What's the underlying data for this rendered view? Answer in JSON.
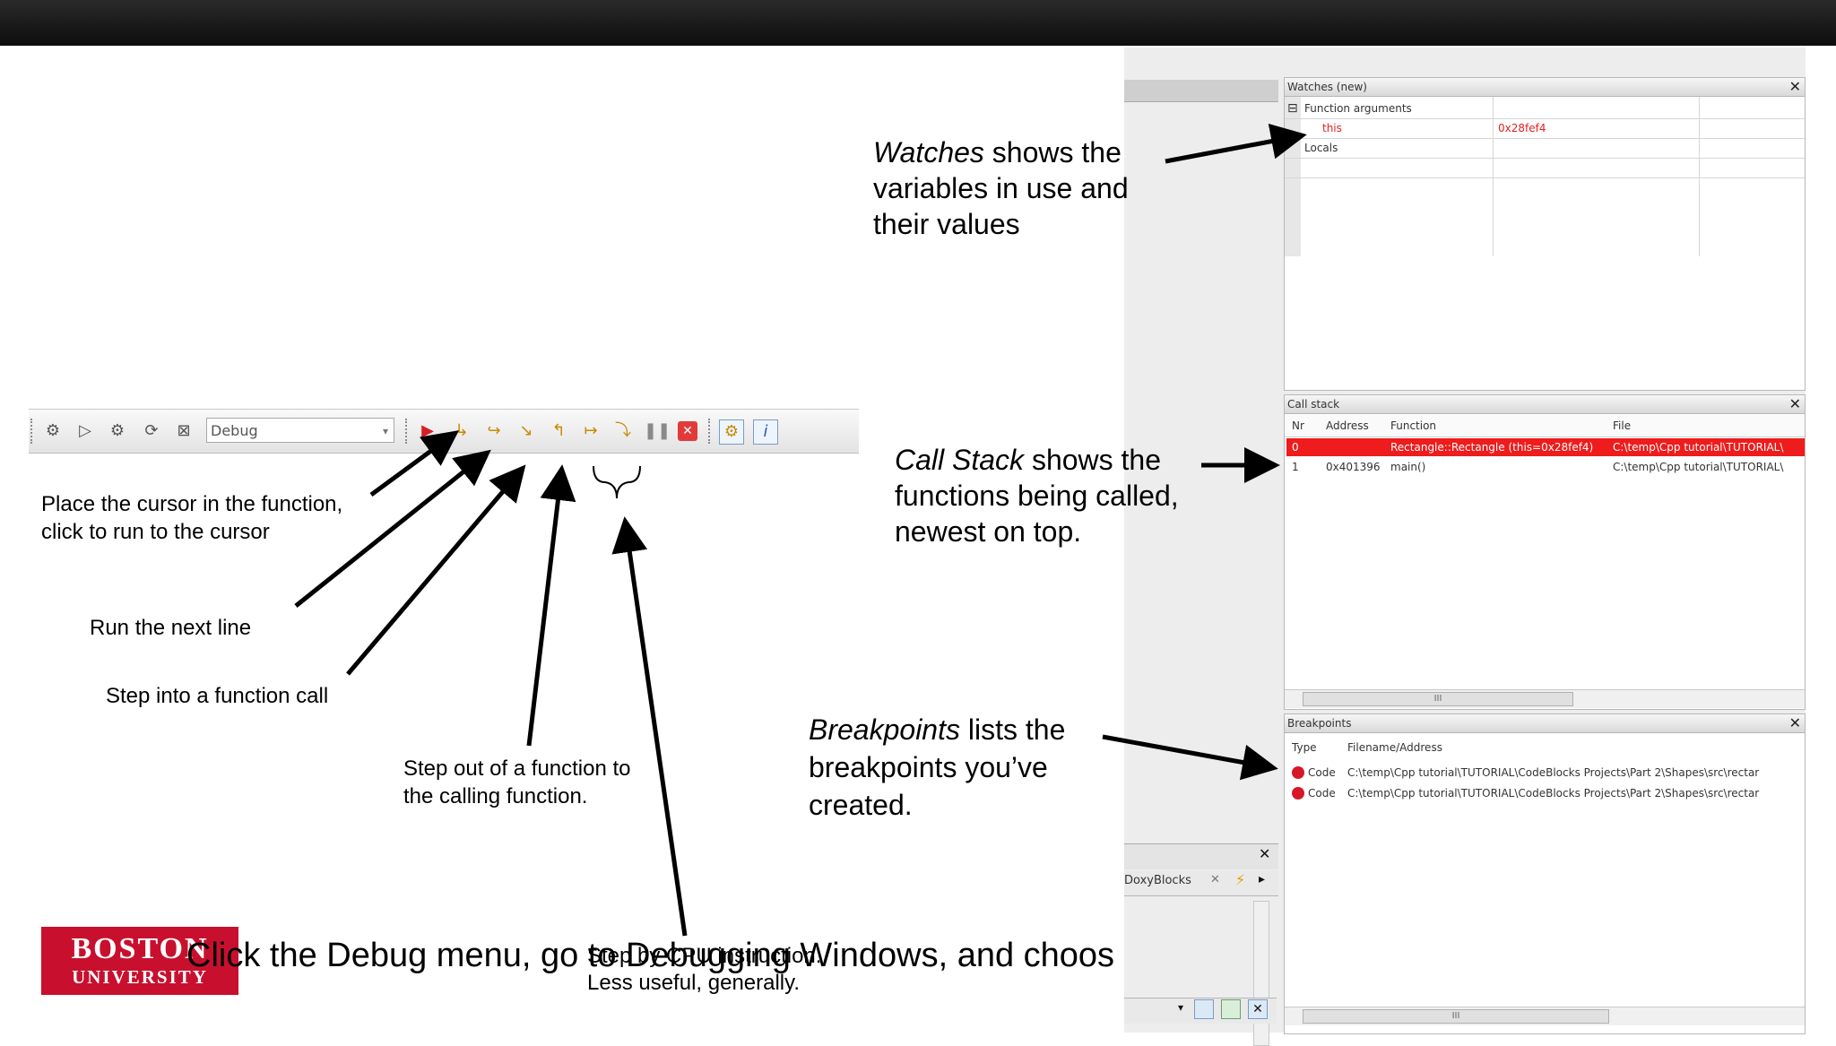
{
  "watches": {
    "title": "Watches (new)",
    "function_arguments": "Function arguments",
    "arg_name": "this",
    "arg_value": "0x28fef4",
    "locals": "Locals",
    "expand_symbol": "⊟"
  },
  "call_stack": {
    "title": "Call stack",
    "columns": [
      "Nr",
      "Address",
      "Function",
      "File"
    ],
    "rows": [
      {
        "nr": "0",
        "address": "",
        "function": "Rectangle::Rectangle (this=0x28fef4)",
        "file": "C:\\temp\\Cpp tutorial\\TUTORIAL\\"
      },
      {
        "nr": "1",
        "address": "0x401396",
        "function": "main()",
        "file": "C:\\temp\\Cpp tutorial\\TUTORIAL\\"
      }
    ],
    "scroll_marker": "III"
  },
  "breakpoints": {
    "title": "Breakpoints",
    "columns": [
      "Type",
      "Filename/Address"
    ],
    "rows": [
      {
        "type": "Code",
        "path": "C:\\temp\\Cpp tutorial\\TUTORIAL\\CodeBlocks Projects\\Part 2\\Shapes\\src\\rectar"
      },
      {
        "type": "Code",
        "path": "C:\\temp\\Cpp tutorial\\TUTORIAL\\CodeBlocks Projects\\Part 2\\Shapes\\src\\rectar"
      }
    ],
    "scroll_marker": "III"
  },
  "side_panel": {
    "doxyblocks_tab": "DoxyBlocks"
  },
  "toolbar": {
    "build_target": "Debug"
  },
  "annotations": {
    "watches": {
      "italic": "Watches",
      "rest": " shows the",
      "line2": "variables in use and",
      "line3": "their values"
    },
    "call_stack": {
      "italic": "Call Stack",
      "rest": " shows the",
      "line2": "functions being called,",
      "line3": "newest on top."
    },
    "breakpoints": {
      "italic": "Breakpoints",
      "rest": " lists the",
      "line2": "breakpoints you’ve",
      "line3": "created."
    },
    "run_to_cursor": {
      "line1": "Place the cursor in the function,",
      "line2": "click to run to the cursor"
    },
    "next_line": "Run the next line",
    "step_into": "Step into a function call",
    "step_out": {
      "line1": "Step out of a function to",
      "line2": "the calling function."
    },
    "cpu_step": {
      "line1": "Step by CPU instruction.",
      "line2": "Less useful, generally."
    },
    "caption": "Click the Debug menu, go to Debugging Windows, and choos"
  },
  "logo": {
    "line1": "BOSTON",
    "line2": "UNIVERSITY"
  }
}
